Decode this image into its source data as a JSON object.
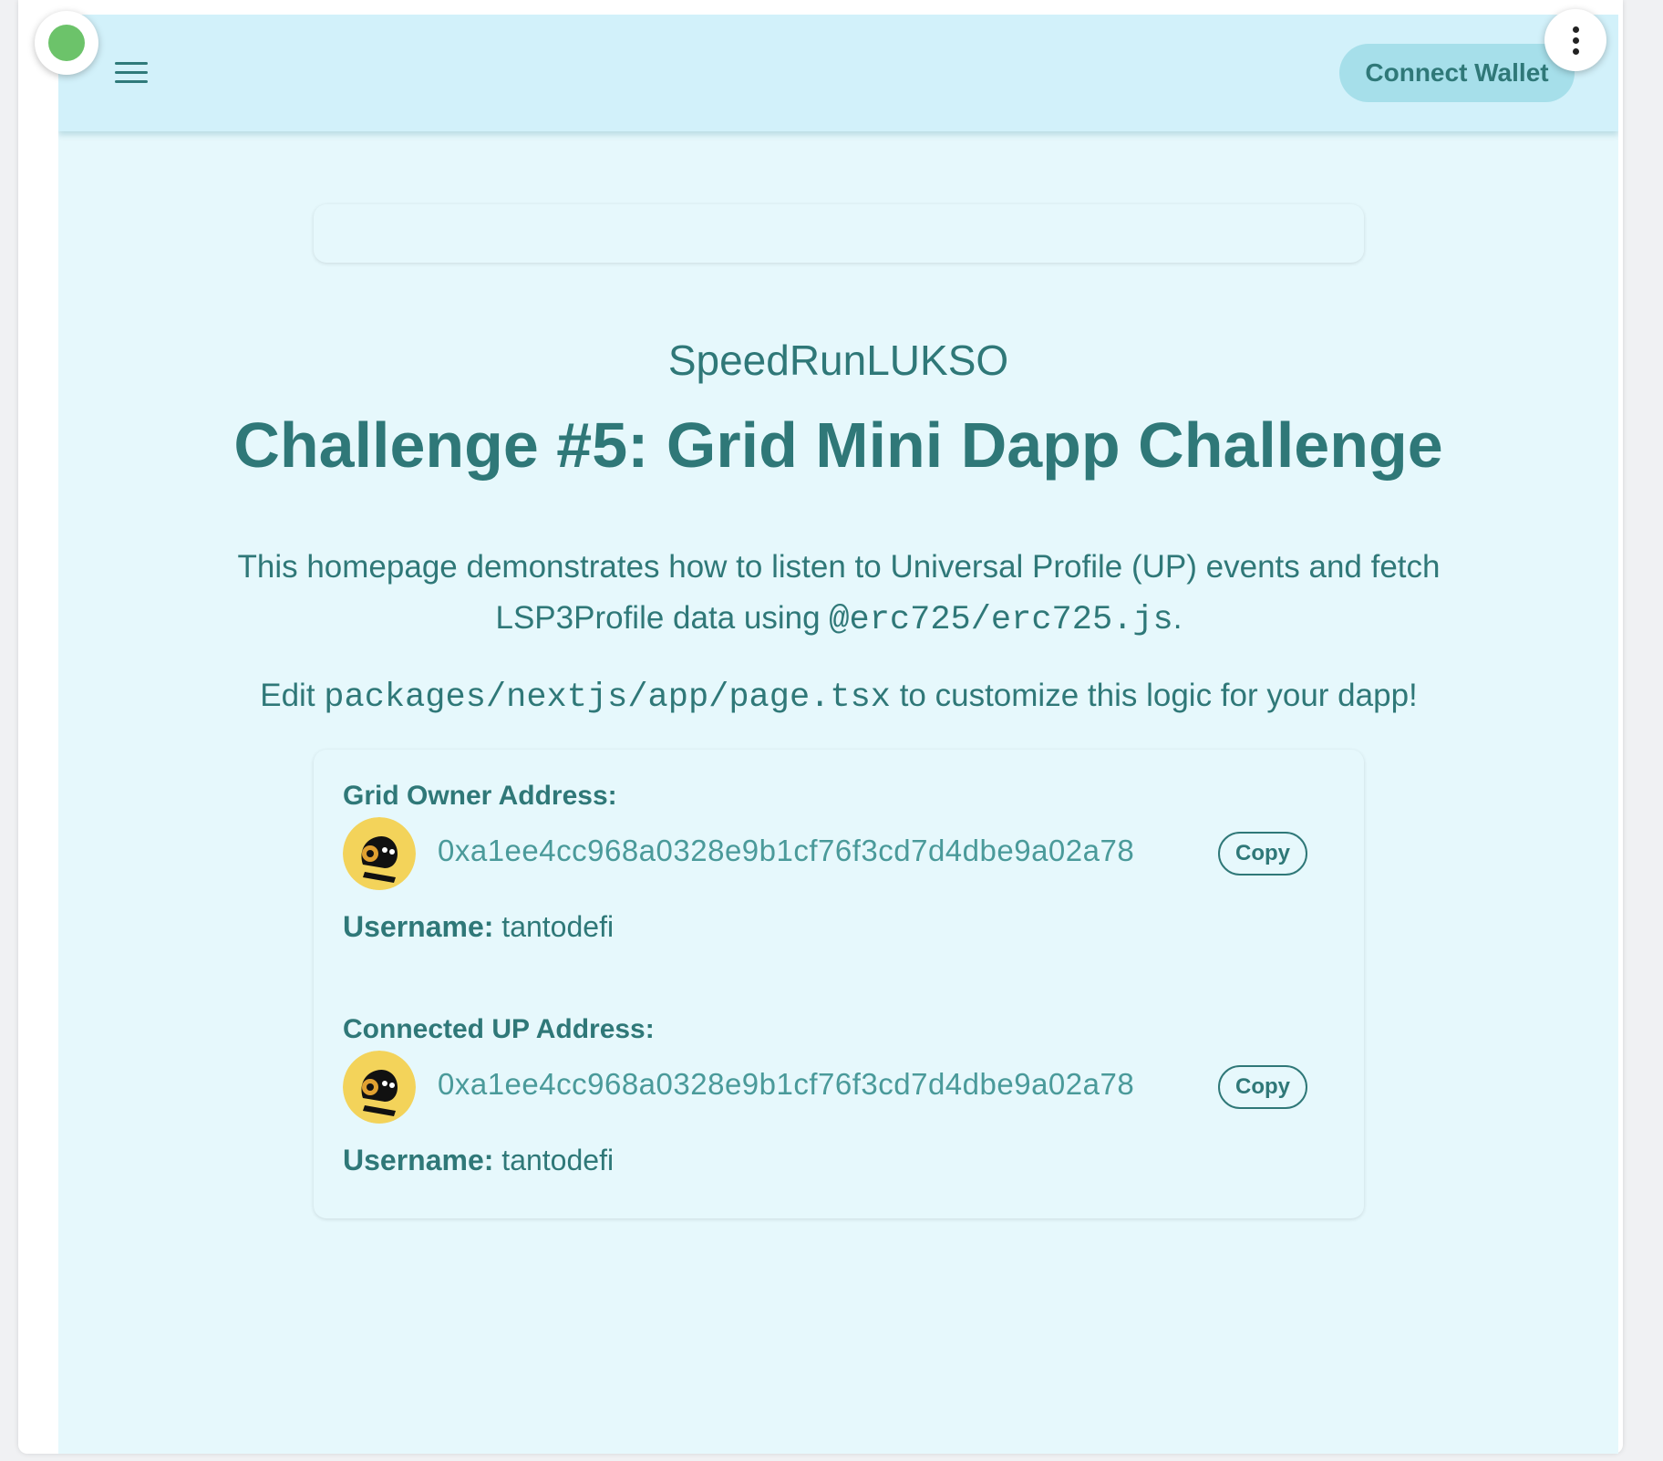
{
  "header": {
    "connect_label": "Connect Wallet"
  },
  "hero": {
    "subtitle": "SpeedRunLUKSO",
    "title": "Challenge #5: Grid Mini Dapp Challenge",
    "desc_part1": "This homepage demonstrates how to listen to Universal Profile (UP) events and fetch LSP3Profile data using ",
    "desc_code": "@erc725/erc725.js",
    "desc_part2": ".",
    "edit_prefix": "Edit ",
    "edit_code": "packages/nextjs/app/page.tsx",
    "edit_suffix": " to customize this logic for your dapp!"
  },
  "grid_owner": {
    "label": "Grid Owner Address:",
    "address": "0xa1ee4cc968a0328e9b1cf76f3cd7d4dbe9a02a78",
    "copy_label": "Copy",
    "username_label": "Username:",
    "username": "tantodefi"
  },
  "connected": {
    "label": "Connected UP Address:",
    "address": "0xa1ee4cc968a0328e9b1cf76f3cd7d4dbe9a02a78",
    "copy_label": "Copy",
    "username_label": "Username:",
    "username": "tantodefi"
  },
  "colors": {
    "accent": "#2f7878",
    "topbar_bg": "#d2f1fa",
    "page_bg": "#e6f8fc",
    "button_bg": "#a6dfea",
    "status_green": "#6cc36a",
    "avatar_yellow": "#f3d35a"
  },
  "icons": {
    "menu": "hamburger-menu-icon",
    "status": "status-dot-icon",
    "more": "more-vertical-icon"
  }
}
